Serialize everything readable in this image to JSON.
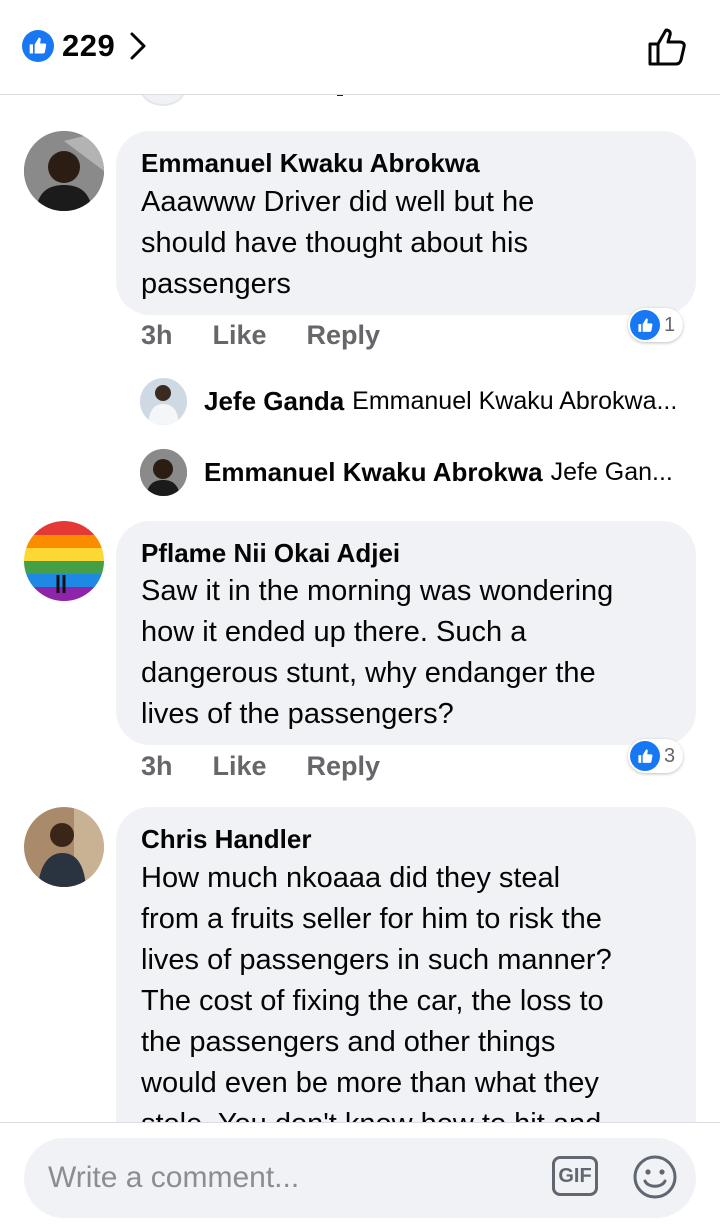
{
  "header": {
    "like_count": "229",
    "icons": [
      "like-badge-icon",
      "chevron-right-icon",
      "thumbs-up-outline-icon"
    ]
  },
  "comments": [
    {
      "author": "Emmanuel Kwaku Abrokwa",
      "text": "Aaawww Driver did well but he\nshould have thought about his\npassengers",
      "time": "3h",
      "like_label": "Like",
      "reply_label": "Reply",
      "reaction_count": "1",
      "replies": [
        {
          "author": "Jefe Ganda",
          "preview": "Emmanuel Kwaku Abrokwa..."
        },
        {
          "author": "Emmanuel Kwaku Abrokwa",
          "preview": "Jefe Gan..."
        }
      ]
    },
    {
      "author": "Pflame Nii Okai Adjei",
      "text": "Saw it in the morning was wondering\nhow it ended up there. Such a\ndangerous stunt, why endanger the\nlives of the passengers?",
      "time": "3h",
      "like_label": "Like",
      "reply_label": "Reply",
      "reaction_count": "3"
    },
    {
      "author": "Chris Handler",
      "text": "How much nkoaaa did they steal\nfrom a fruits seller for him to risk the\nlives of passengers in such manner?\nThe cost of fixing the car, the loss to\nthe passengers and other things\nwould even be more than what they\nstole. You don't know how to hit and"
    }
  ],
  "composer": {
    "placeholder": "Write a comment...",
    "gif_label": "GIF"
  },
  "colors": {
    "accent": "#1877f2",
    "bubble": "#f0f2f5",
    "meta_text": "#65676b"
  }
}
